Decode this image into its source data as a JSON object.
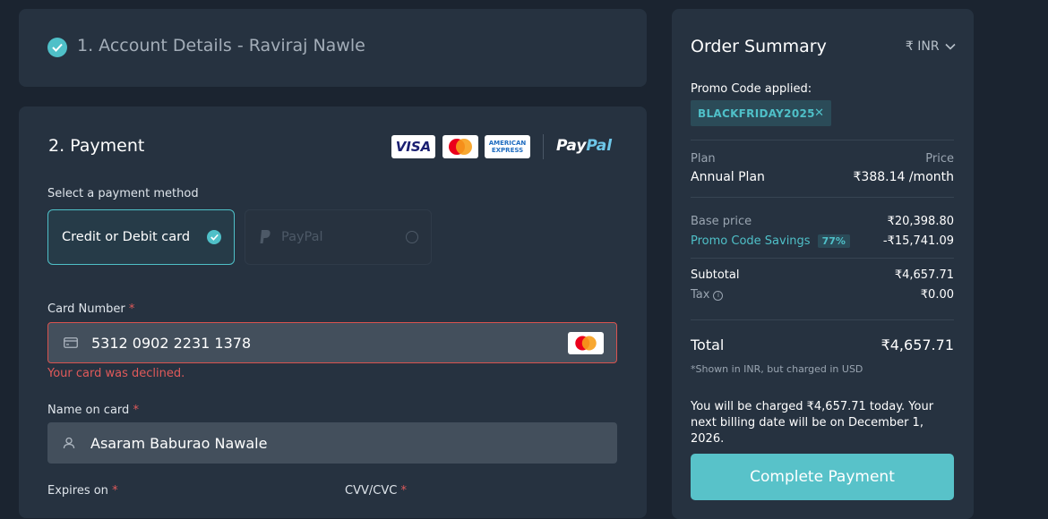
{
  "account": {
    "title": "1. Account Details - Raviraj Nawle"
  },
  "payment": {
    "title": "2. Payment",
    "logos": {
      "visa": "VISA",
      "amex_line1": "AMERICAN",
      "amex_line2": "EXPRESS",
      "paypal_a": "Pay",
      "paypal_b": "Pal"
    },
    "select_label": "Select a payment method",
    "methods": [
      {
        "label": "Credit or Debit card",
        "selected": true
      },
      {
        "label": "PayPal",
        "selected": false
      }
    ],
    "card_number": {
      "label": "Card Number",
      "required": "*",
      "value": "5312 0902 2231 1378",
      "error": "Your card was declined."
    },
    "name_on_card": {
      "label": "Name on card",
      "required": "*",
      "value": "Asaram Baburao Nawale"
    },
    "expires": {
      "label": "Expires on",
      "required": "*"
    },
    "cvv": {
      "label": "CVV/CVC",
      "required": "*"
    }
  },
  "summary": {
    "title": "Order Summary",
    "currency": "₹ INR",
    "promo_label": "Promo Code applied:",
    "promo_code": "BLACKFRIDAY2025",
    "plan_header": "Plan",
    "price_header": "Price",
    "plan_name": "Annual Plan",
    "plan_price": "₹388.14 /month",
    "base_price_label": "Base price",
    "base_price": "₹20,398.80",
    "savings_label": "Promo Code Savings",
    "savings_pct": "77%",
    "savings": "-₹15,741.09",
    "subtotal_label": "Subtotal",
    "subtotal": "₹4,657.71",
    "tax_label": "Tax",
    "tax": "₹0.00",
    "total_label": "Total",
    "total": "₹4,657.71",
    "footnote": "*Shown in INR, but charged in USD",
    "charge_note": "You will be charged ₹4,657.71 today. Your next billing date will be on December 1, 2026.",
    "cta": "Complete Payment"
  },
  "colors": {
    "accent": "#4fc0c8",
    "error": "#d9534f",
    "background": "#1b2430",
    "panel": "#263240"
  }
}
